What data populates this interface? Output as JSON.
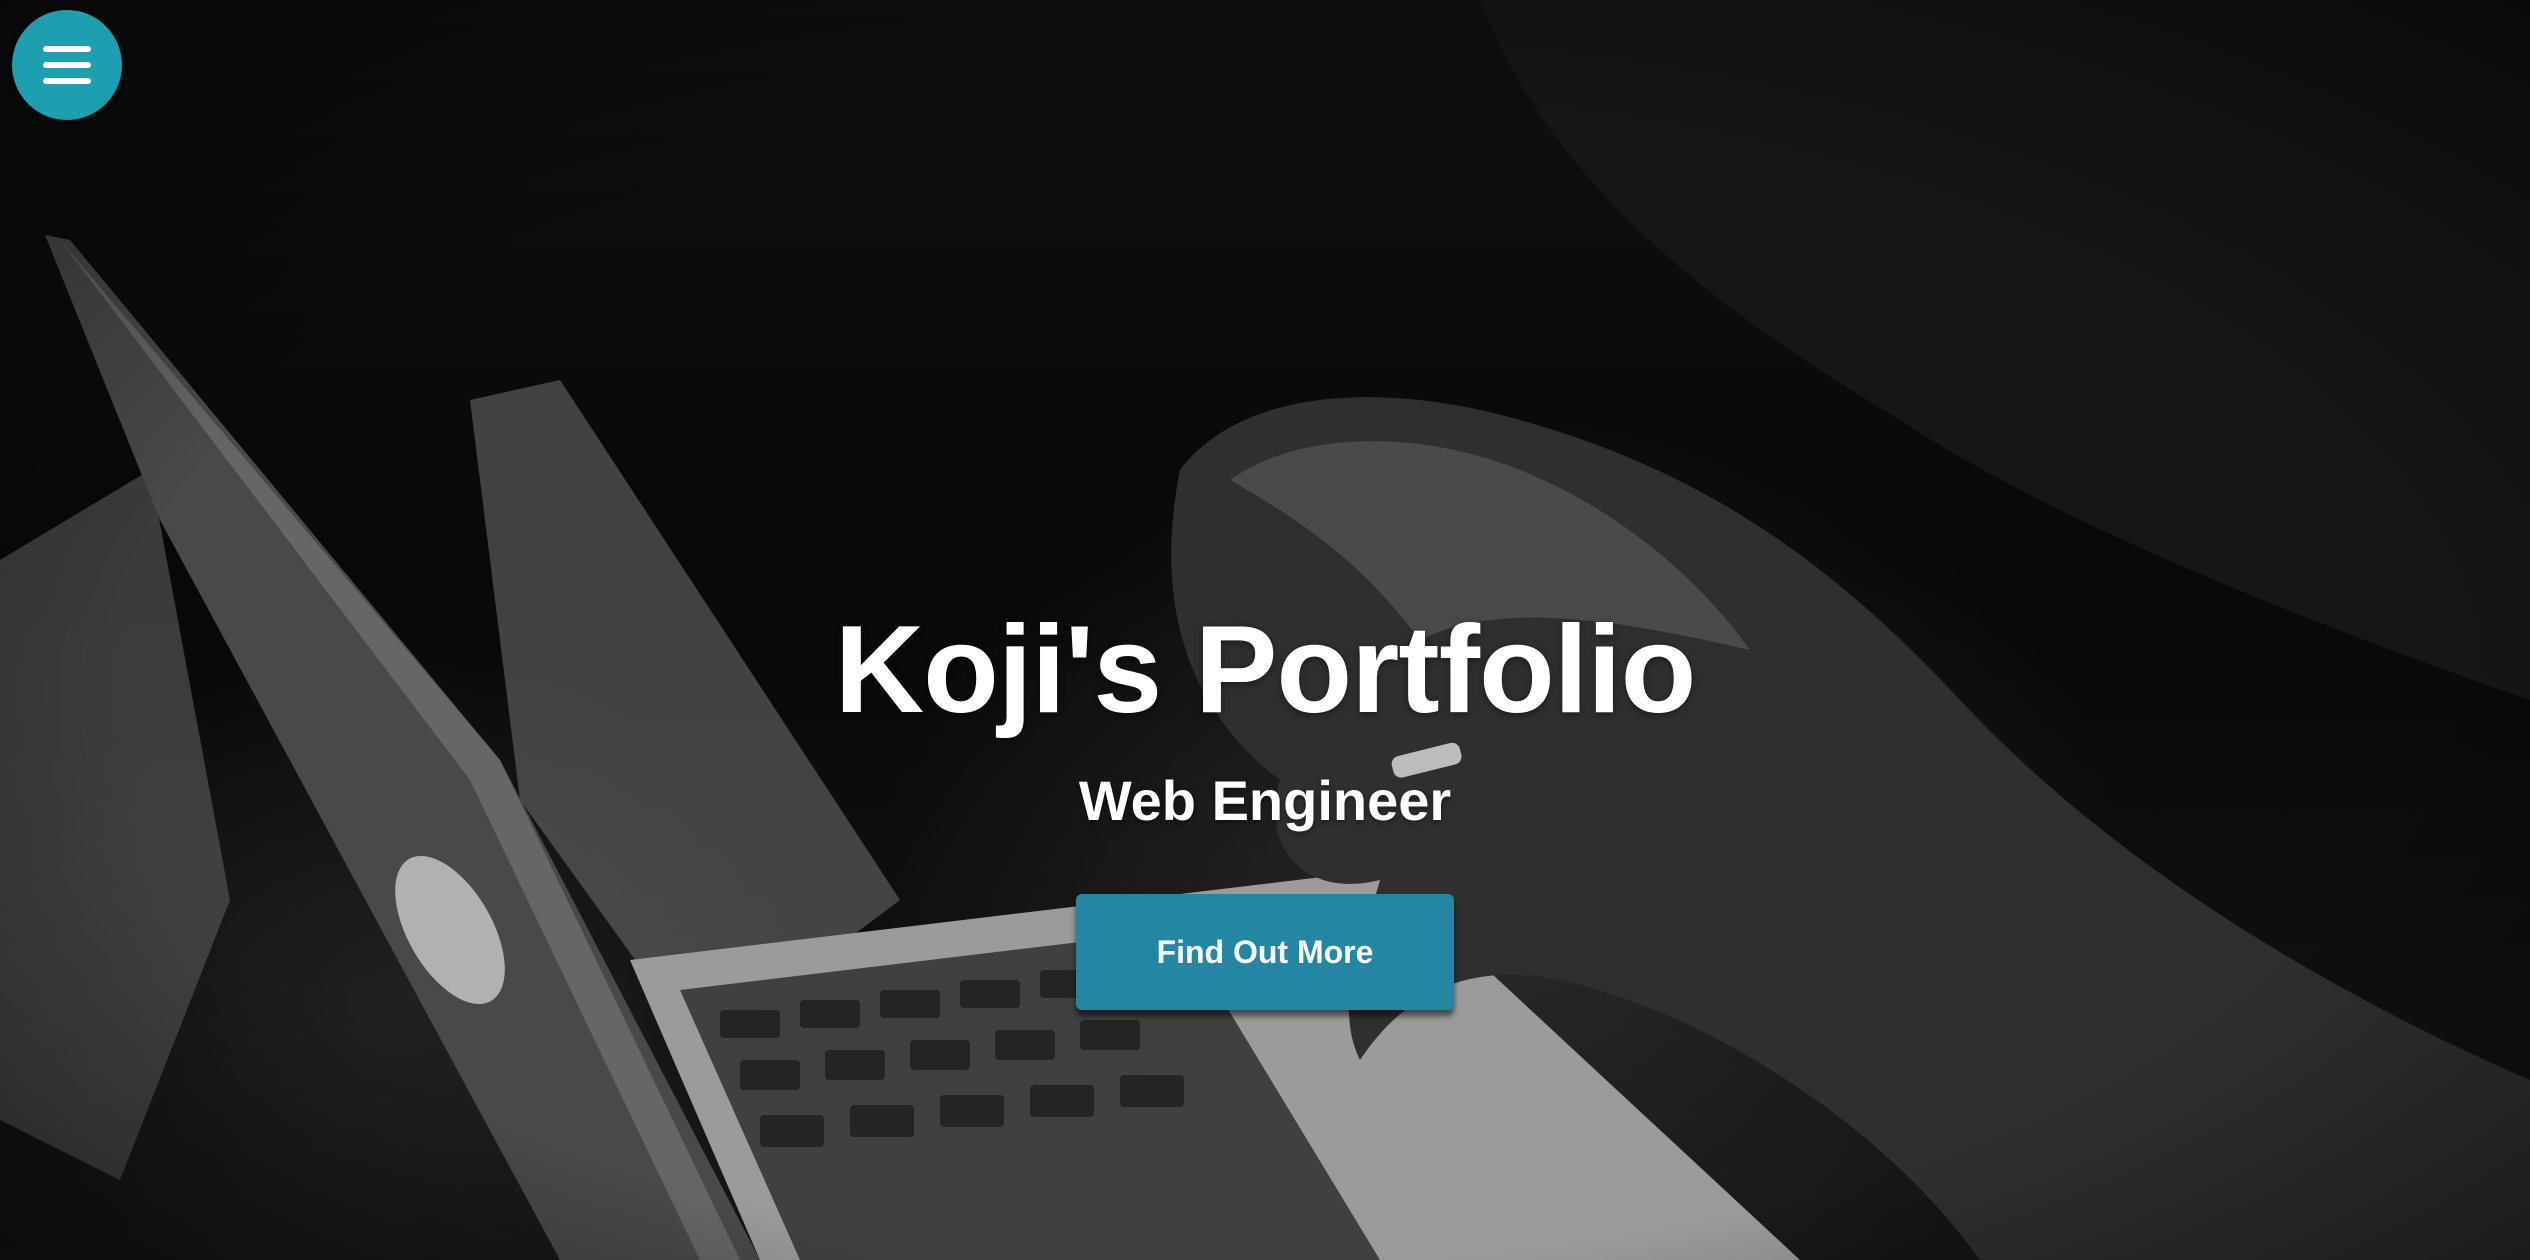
{
  "hero": {
    "title": "Koji's Portfolio",
    "subtitle": "Web Engineer",
    "cta_label": "Find Out More"
  },
  "nav": {
    "menu_icon": "hamburger-menu-icon"
  },
  "colors": {
    "menu_button": "#1d9fb0",
    "cta_button": "#2387a4",
    "text": "#ffffff"
  },
  "background": {
    "style": "black-and-white photo of hands typing on a laptop"
  }
}
